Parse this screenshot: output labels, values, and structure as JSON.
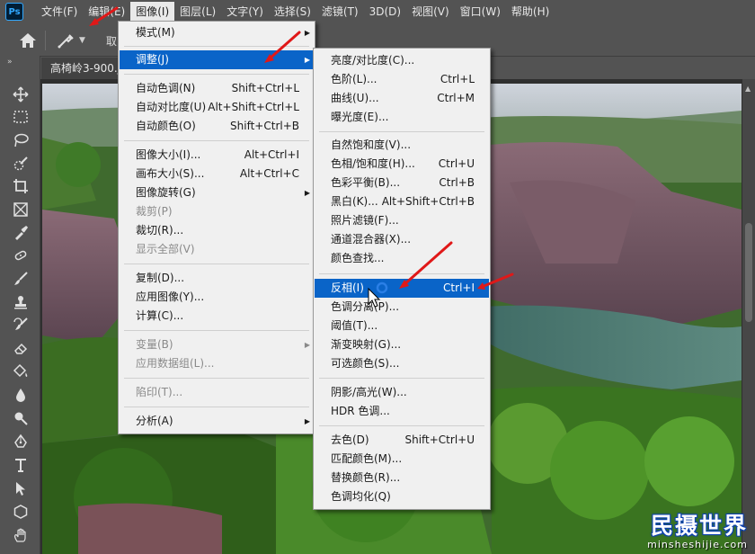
{
  "app": {
    "logo": "Ps"
  },
  "menubar": {
    "items": [
      "文件(F)",
      "编辑(E)",
      "图像(I)",
      "图层(L)",
      "文字(Y)",
      "选择(S)",
      "滤镜(T)",
      "3D(D)",
      "视图(V)",
      "窗口(W)",
      "帮助(H)"
    ]
  },
  "options": {
    "label": "取"
  },
  "document": {
    "tab_title": "高椅岭3-900.jpg"
  },
  "image_menu": {
    "mode": "模式(M)",
    "adjust": "调整(J)",
    "auto_tone": {
      "label": "自动色调(N)",
      "shortcut": "Shift+Ctrl+L"
    },
    "auto_contrast": {
      "label": "自动对比度(U)",
      "shortcut": "Alt+Shift+Ctrl+L"
    },
    "auto_color": {
      "label": "自动颜色(O)",
      "shortcut": "Shift+Ctrl+B"
    },
    "image_size": {
      "label": "图像大小(I)...",
      "shortcut": "Alt+Ctrl+I"
    },
    "canvas_size": {
      "label": "画布大小(S)...",
      "shortcut": "Alt+Ctrl+C"
    },
    "rotation": "图像旋转(G)",
    "crop": "裁剪(P)",
    "trim": "裁切(R)...",
    "reveal_all": "显示全部(V)",
    "duplicate": "复制(D)...",
    "apply_image": "应用图像(Y)...",
    "calculations": "计算(C)...",
    "variables": "变量(B)",
    "apply_dataset": "应用数据组(L)...",
    "trap": "陷印(T)...",
    "analysis": "分析(A)"
  },
  "adjust_menu": {
    "brightness": "亮度/对比度(C)...",
    "levels": {
      "label": "色阶(L)...",
      "shortcut": "Ctrl+L"
    },
    "curves": {
      "label": "曲线(U)...",
      "shortcut": "Ctrl+M"
    },
    "exposure": "曝光度(E)...",
    "vibrance": "自然饱和度(V)...",
    "hue_sat": {
      "label": "色相/饱和度(H)...",
      "shortcut": "Ctrl+U"
    },
    "color_balance": {
      "label": "色彩平衡(B)...",
      "shortcut": "Ctrl+B"
    },
    "bw": {
      "label": "黑白(K)...",
      "shortcut": "Alt+Shift+Ctrl+B"
    },
    "photo_filter": "照片滤镜(F)...",
    "channel_mixer": "通道混合器(X)...",
    "color_lookup": "颜色查找...",
    "invert": {
      "label": "反相(I)",
      "shortcut": "Ctrl+I"
    },
    "posterize": "色调分离(P)...",
    "threshold": "阈值(T)...",
    "gradient_map": "渐变映射(G)...",
    "selective_color": "可选颜色(S)...",
    "shadows_highlights": "阴影/高光(W)...",
    "hdr_toning": "HDR 色调...",
    "desaturate": {
      "label": "去色(D)",
      "shortcut": "Shift+Ctrl+U"
    },
    "match_color": "匹配颜色(M)...",
    "replace_color": "替换颜色(R)...",
    "equalize": "色调均化(Q)"
  },
  "watermark": {
    "brand": "民摄世界",
    "url": "minsheshijie.com"
  },
  "colors": {
    "highlight": "#0a64c8",
    "menu_bg": "#f0f0f0",
    "ui_bg": "#535353",
    "arrow": "#e01818"
  }
}
